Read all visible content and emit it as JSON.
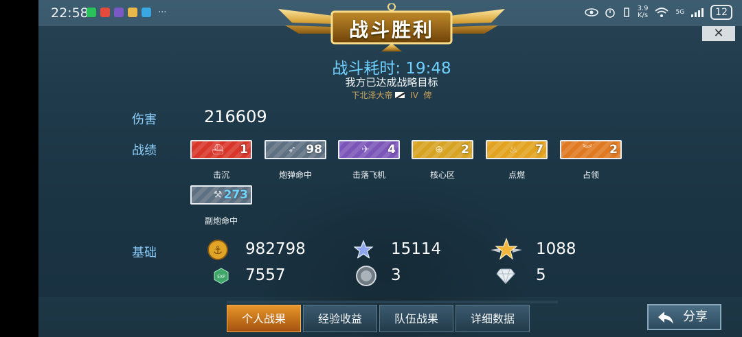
{
  "status_bar": {
    "time": "22:58",
    "notif_more": "···",
    "net_speed_top": "3.9",
    "net_speed_bottom": "K/s",
    "net_type": "5G",
    "battery": "12"
  },
  "header": {
    "title": "战斗胜利",
    "close_label": "✕",
    "duration_label": "战斗耗时:",
    "duration_value": "19:48",
    "objective": "我方已达成战略目标",
    "ship_name": "下北泽大帝",
    "ship_tier": "IV",
    "ship_class": "俾"
  },
  "stats": {
    "damage_label": "伤害",
    "damage_value": "216609",
    "achievements_label": "战绩",
    "basics_label": "基础"
  },
  "medals": [
    {
      "label": "击沉",
      "count": "1",
      "color": "#d8362b",
      "icon": "sinking-ship-icon"
    },
    {
      "label": "炮弹命中",
      "count": "98",
      "color": "#5e7182",
      "icon": "shell-icon"
    },
    {
      "label": "击落飞机",
      "count": "4",
      "color": "#7b56b8",
      "icon": "planes-icon"
    },
    {
      "label": "核心区",
      "count": "2",
      "color": "#d7a323",
      "icon": "citadel-icon"
    },
    {
      "label": "点燃",
      "count": "7",
      "color": "#e2a320",
      "icon": "fire-icon"
    },
    {
      "label": "占领",
      "count": "2",
      "color": "#e07a22",
      "icon": "capture-icon"
    },
    {
      "label": "副炮命中",
      "count": "273",
      "color": "#5e7182",
      "icon": "secondary-gun-icon"
    }
  ],
  "resources": [
    {
      "icon": "gold-coin-icon",
      "value": "982798",
      "color": "#e0a526"
    },
    {
      "icon": "blue-star-icon",
      "value": "15114",
      "color": "#8ea6ee"
    },
    {
      "icon": "gold-star-icon",
      "value": "1088",
      "color": "#f0b53a"
    },
    {
      "icon": "exp-icon",
      "value": "7557",
      "color": "#3fa66a",
      "badge": "EXP"
    },
    {
      "icon": "silver-medal-icon",
      "value": "3",
      "color": "#9aa3aa"
    },
    {
      "icon": "diamond-icon",
      "value": "5",
      "color": "#e8eef2"
    }
  ],
  "tabs": [
    {
      "label": "个人战果",
      "active": true
    },
    {
      "label": "经验收益",
      "active": false
    },
    {
      "label": "队伍战果",
      "active": false
    },
    {
      "label": "详细数据",
      "active": false
    }
  ],
  "share": {
    "label": "分享"
  }
}
